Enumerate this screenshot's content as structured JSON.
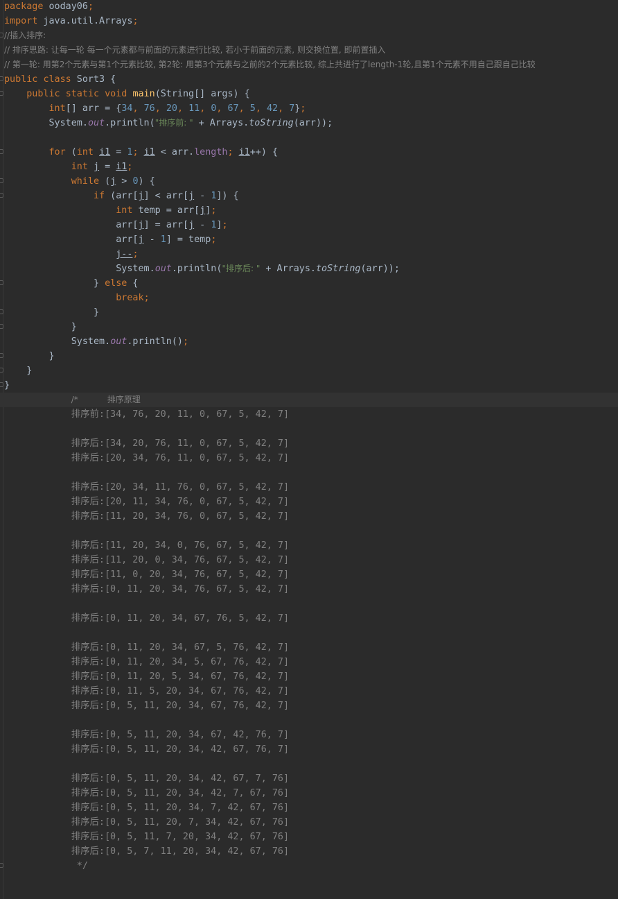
{
  "code": {
    "package_kw": "package",
    "package_name": " ooday06",
    "import_kw": "import",
    "import_name": " java.util.Arrays",
    "comment1": "//插入排序:",
    "comment2": "// 排序思路: 让每一轮 每一个元素都与前面的元素进行比较, 若小于前面的元素, 则交换位置, 即前置插入",
    "comment3": "// 第一轮: 用第2个元素与第1个元素比较, 第2轮: 用第3个元素与之前的2个元素比较, 综上共进行了length-1轮,且第1个元素不用自己跟自己比较",
    "public_kw": "public",
    "class_kw": "class",
    "class_name": " Sort3 {",
    "static_kw": "static",
    "void_kw": "void",
    "main_name": "main",
    "main_params": "(String[] args) {",
    "int_arr_kw": "int",
    "arr_decl": "[] arr = {",
    "arr_values": [
      "34",
      "76",
      "20",
      "11",
      "0",
      "67",
      "5",
      "42",
      "7"
    ],
    "system": "System.",
    "out": "out",
    "println": ".println(",
    "str_before": "\"排序前: \"",
    "plus_arrays": " + Arrays.",
    "tostring": "toString",
    "arr_close": "(arr));",
    "for_kw": "for",
    "for_open": " (",
    "int_kw": "int",
    "i1": "i1",
    "eq_one": " = ",
    "one": "1",
    "lt": " < arr.",
    "length": "length",
    "incr": "++) {",
    "j": "j",
    "eq": " = ",
    "while_kw": "while",
    "while_cond": " (",
    "gt": " > ",
    "zero": "0",
    "brace_open": ") {",
    "if_kw": "if",
    "if_cond_a": " (arr[",
    "if_cond_b": "] < arr[",
    "minus": " - ",
    "if_cond_c": "]) {",
    "temp_decl": " temp = arr[",
    "close_bracket": "]",
    "arr_open": "arr[",
    "assign_arr": "] = arr[",
    "assign_temp": "] = temp",
    "jdec": "j--",
    "str_after": "\"排序后: \"",
    "else_open": "} ",
    "else_kw": "else",
    "else_brace": " {",
    "break_kw": "break",
    "close_brace": "}",
    "println_empty": ".println()",
    "comment_start": "/*           排序原理",
    "comment_end": " */"
  },
  "output_lines": [
    "排序前:[34, 76, 20, 11, 0, 67, 5, 42, 7]",
    "",
    "排序后:[34, 20, 76, 11, 0, 67, 5, 42, 7]",
    "排序后:[20, 34, 76, 11, 0, 67, 5, 42, 7]",
    "",
    "排序后:[20, 34, 11, 76, 0, 67, 5, 42, 7]",
    "排序后:[20, 11, 34, 76, 0, 67, 5, 42, 7]",
    "排序后:[11, 20, 34, 76, 0, 67, 5, 42, 7]",
    "",
    "排序后:[11, 20, 34, 0, 76, 67, 5, 42, 7]",
    "排序后:[11, 20, 0, 34, 76, 67, 5, 42, 7]",
    "排序后:[11, 0, 20, 34, 76, 67, 5, 42, 7]",
    "排序后:[0, 11, 20, 34, 76, 67, 5, 42, 7]",
    "",
    "排序后:[0, 11, 20, 34, 67, 76, 5, 42, 7]",
    "",
    "排序后:[0, 11, 20, 34, 67, 5, 76, 42, 7]",
    "排序后:[0, 11, 20, 34, 5, 67, 76, 42, 7]",
    "排序后:[0, 11, 20, 5, 34, 67, 76, 42, 7]",
    "排序后:[0, 11, 5, 20, 34, 67, 76, 42, 7]",
    "排序后:[0, 5, 11, 20, 34, 67, 76, 42, 7]",
    "",
    "排序后:[0, 5, 11, 20, 34, 67, 42, 76, 7]",
    "排序后:[0, 5, 11, 20, 34, 42, 67, 76, 7]",
    "",
    "排序后:[0, 5, 11, 20, 34, 42, 67, 7, 76]",
    "排序后:[0, 5, 11, 20, 34, 42, 7, 67, 76]",
    "排序后:[0, 5, 11, 20, 34, 7, 42, 67, 76]",
    "排序后:[0, 5, 11, 20, 7, 34, 42, 67, 76]",
    "排序后:[0, 5, 11, 7, 20, 34, 42, 67, 76]",
    "排序后:[0, 5, 7, 11, 20, 34, 42, 67, 76]"
  ],
  "colors": {
    "background": "#2b2b2b",
    "keyword": "#cc7832",
    "function": "#ffc66d",
    "number": "#6897bb",
    "string": "#6a8759",
    "comment": "#808080",
    "field": "#9876aa",
    "text": "#a9b7c6"
  }
}
